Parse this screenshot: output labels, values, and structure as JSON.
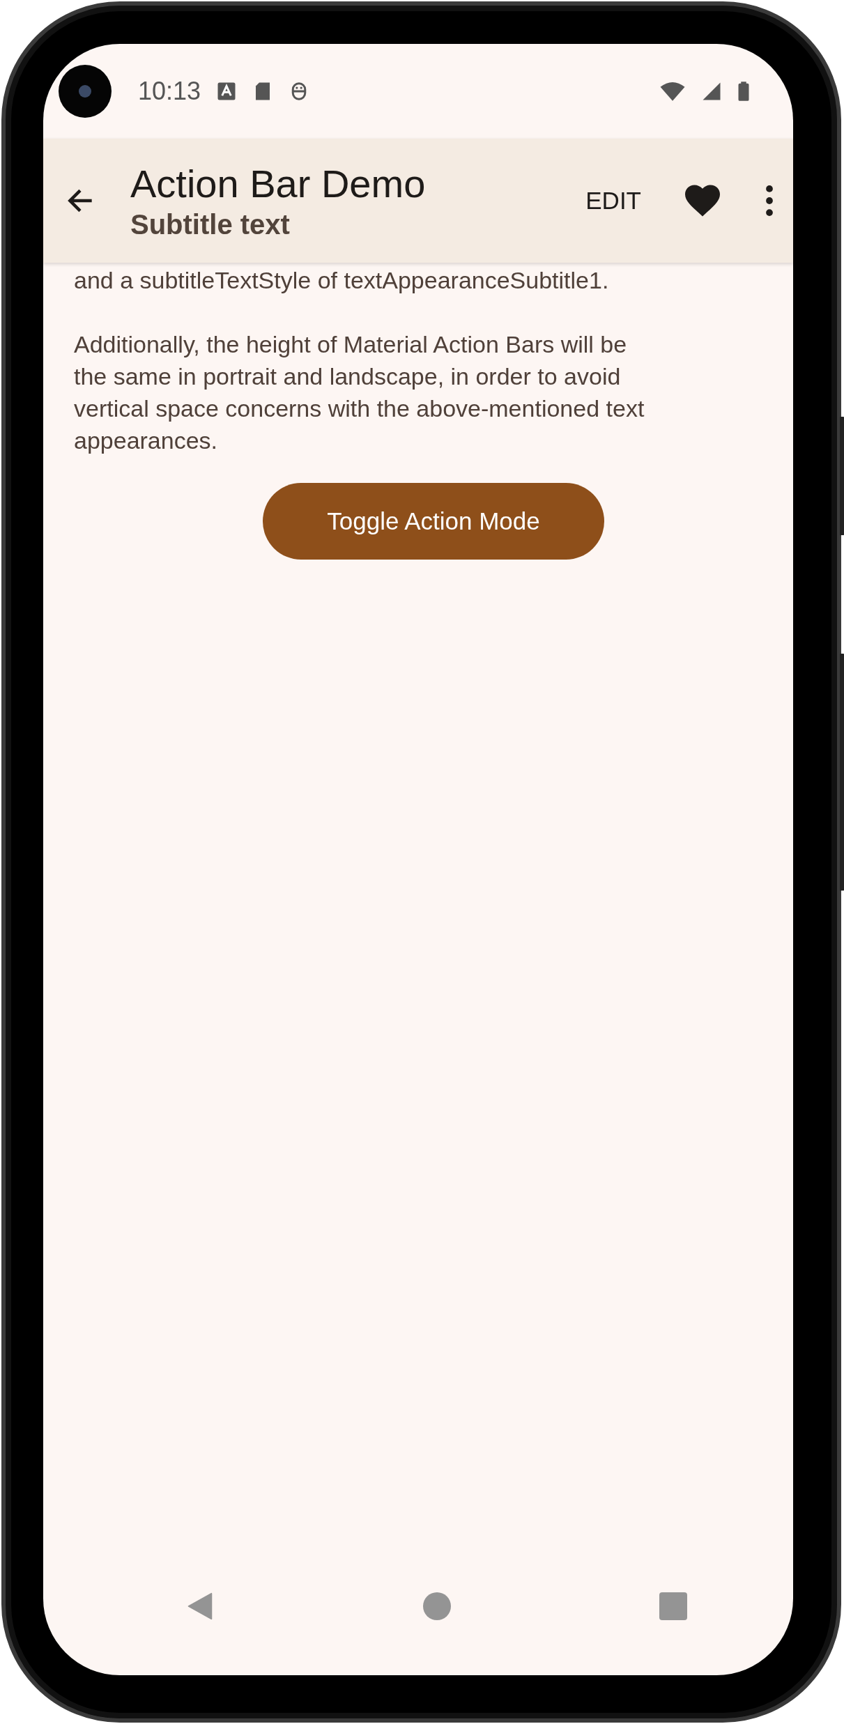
{
  "status_bar": {
    "time": "10:13"
  },
  "action_bar": {
    "title": "Action Bar Demo",
    "subtitle": "Subtitle text",
    "actions": [
      "EDIT"
    ]
  },
  "content": {
    "paragraphs": [
      {
        "lines": [
          "and a subtitleTextStyle of textAppearanceSubtitle1."
        ]
      },
      {
        "lines": [
          "Additionally, the height of Material Action Bars will be",
          "the same in portrait and landscape, in order to avoid",
          "vertical space concerns with the above-mentioned text",
          "appearances."
        ]
      }
    ],
    "button": "Toggle Action Mode"
  }
}
